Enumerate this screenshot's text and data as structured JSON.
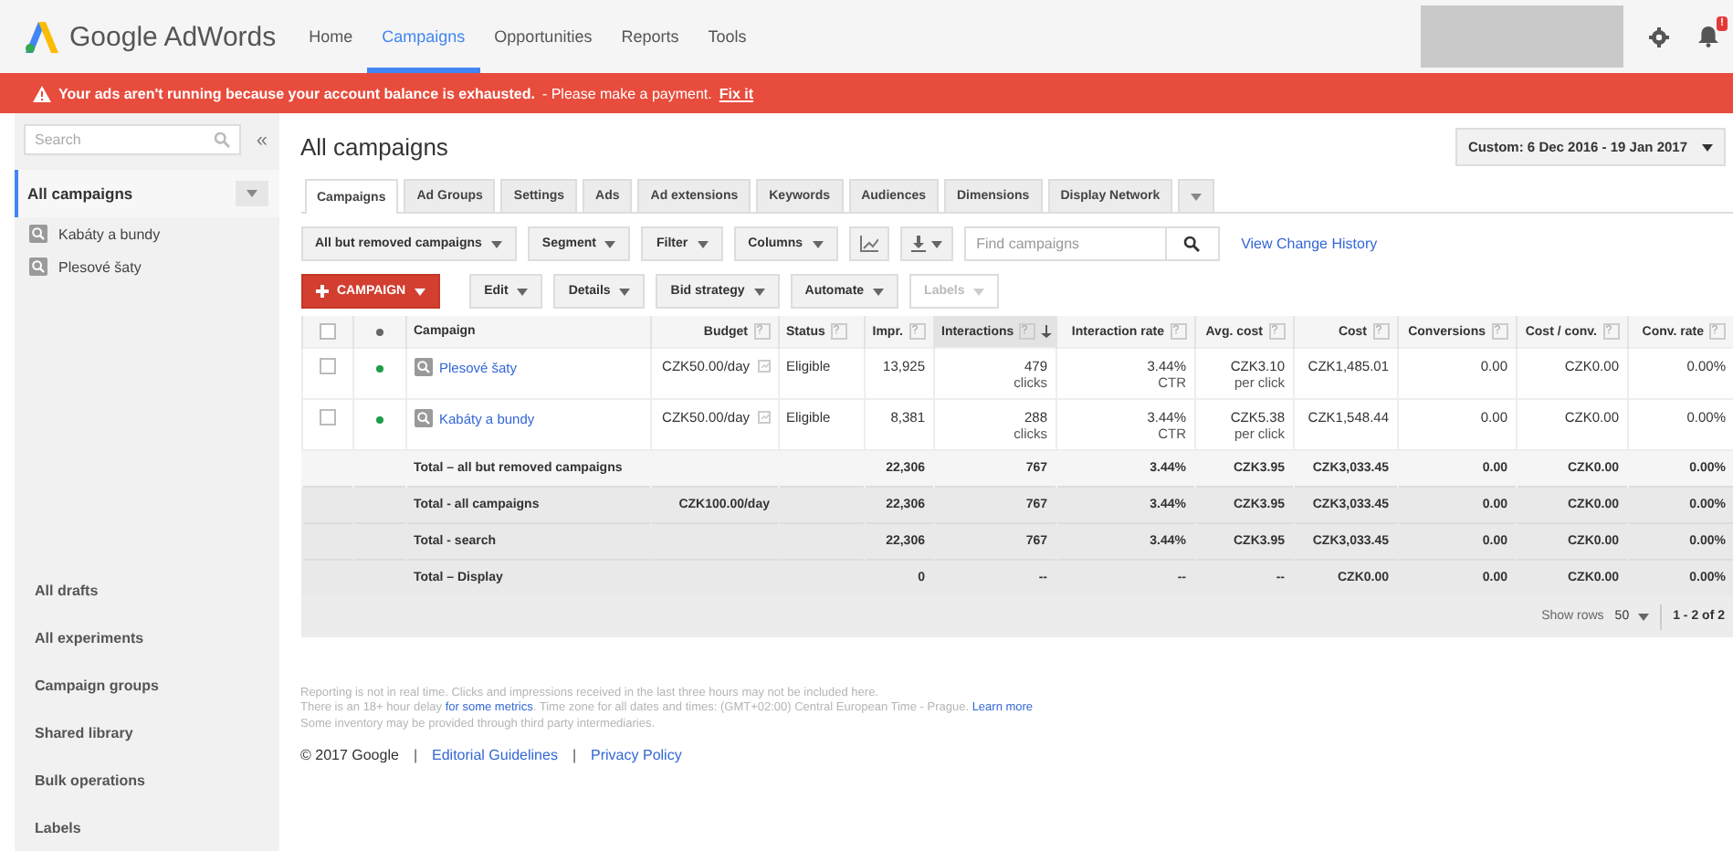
{
  "nav": {
    "brand": "Google AdWords",
    "items": [
      {
        "label": "Home",
        "selected": false
      },
      {
        "label": "Campaigns",
        "selected": true
      },
      {
        "label": "Opportunities",
        "selected": false
      },
      {
        "label": "Reports",
        "selected": false
      },
      {
        "label": "Tools",
        "selected": false
      }
    ],
    "notification_badge": "!"
  },
  "alert": {
    "message": "Your ads aren't running because your account balance is exhausted.",
    "note": "- Please make a payment.",
    "link": "Fix it"
  },
  "sidebar": {
    "search": {
      "placeholder": "Search"
    },
    "collapse": "«",
    "scope": {
      "label": "All campaigns",
      "selected": true
    },
    "campaigns": [
      {
        "label": "Kabáty a bundy",
        "selected": false
      },
      {
        "label": "Plesové šaty",
        "selected": false
      }
    ],
    "links": [
      "All drafts",
      "All experiments",
      "Campaign groups",
      "Shared library",
      "Bulk operations",
      "Labels"
    ]
  },
  "page_title": "All campaigns",
  "date_range": "Custom: 6 Dec 2016 - 19 Jan 2017",
  "tabs": [
    {
      "label": "Campaigns",
      "selected": true
    },
    {
      "label": "Ad Groups",
      "selected": false
    },
    {
      "label": "Settings",
      "selected": false
    },
    {
      "label": "Ads",
      "selected": false
    },
    {
      "label": "Ad extensions",
      "selected": false
    },
    {
      "label": "Keywords",
      "selected": false
    },
    {
      "label": "Audiences",
      "selected": false
    },
    {
      "label": "Dimensions",
      "selected": false
    },
    {
      "label": "Display Network",
      "selected": false
    }
  ],
  "toolbar": {
    "filters": [
      "All but removed campaigns",
      "Segment",
      "Filter",
      "Columns"
    ],
    "search": {
      "placeholder": "Find campaigns"
    },
    "link": "View Change History"
  },
  "actions": [
    {
      "label": "CAMPAIGN",
      "kind": "primary",
      "disabled": false
    },
    {
      "label": "Edit",
      "kind": "menu",
      "disabled": false
    },
    {
      "label": "Details",
      "kind": "menu",
      "disabled": false
    },
    {
      "label": "Bid strategy",
      "kind": "menu",
      "disabled": false
    },
    {
      "label": "Automate",
      "kind": "menu",
      "disabled": false
    },
    {
      "label": "Labels",
      "kind": "menu",
      "disabled": true
    }
  ],
  "table": {
    "columns": [
      {
        "kind": "checkbox",
        "checked": false
      },
      {
        "kind": "dot"
      },
      {
        "kind": "text",
        "label": "Campaign",
        "help": false,
        "sorted": false
      },
      {
        "kind": "number",
        "label": "Budget",
        "help": true,
        "sorted": false
      },
      {
        "kind": "text",
        "label": "Status",
        "help": true,
        "sorted": false
      },
      {
        "kind": "number",
        "label": "Impr.",
        "help": true,
        "sorted": false
      },
      {
        "kind": "number",
        "label": "Interactions",
        "help": true,
        "sorted": true
      },
      {
        "kind": "number",
        "label": "Interaction rate",
        "help": true,
        "sorted": false
      },
      {
        "kind": "number",
        "label": "Avg. cost",
        "help": true,
        "sorted": false
      },
      {
        "kind": "number",
        "label": "Cost",
        "help": true,
        "sorted": false
      },
      {
        "kind": "number",
        "label": "Conversions",
        "help": true,
        "sorted": false
      },
      {
        "kind": "number",
        "label": "Cost / conv.",
        "help": true,
        "sorted": false
      },
      {
        "kind": "number",
        "label": "Conv. rate",
        "help": true,
        "sorted": false
      }
    ],
    "rows": [
      {
        "kind": "campaign",
        "checked": false,
        "color": "#1e9e4a",
        "cells": [
          null,
          null,
          "Plesové šaty",
          "CZK50.00/day",
          "Eligible",
          "13,925",
          {
            "value": "479",
            "unit": "clicks"
          },
          {
            "value": "3.44%",
            "unit": "CTR"
          },
          {
            "value": "CZK3.10",
            "unit": "per click"
          },
          "CZK1,485.01",
          "0.00",
          "CZK0.00",
          "0.00%"
        ]
      },
      {
        "kind": "campaign",
        "checked": false,
        "color": "#1e9e4a",
        "cells": [
          null,
          null,
          "Kabáty a bundy",
          "CZK50.00/day",
          "Eligible",
          "8,381",
          {
            "value": "288",
            "unit": "clicks"
          },
          {
            "value": "3.44%",
            "unit": "CTR"
          },
          {
            "value": "CZK5.38",
            "unit": "per click"
          },
          "CZK1,548.44",
          "0.00",
          "CZK0.00",
          "0.00%"
        ]
      },
      {
        "kind": "total",
        "shaded": false,
        "cells": [
          null,
          null,
          "Total – all but removed campaigns",
          null,
          null,
          "22,306",
          "767",
          "3.44%",
          "CZK3.95",
          "CZK3,033.45",
          "0.00",
          "CZK0.00",
          "0.00%"
        ]
      },
      {
        "kind": "total",
        "shaded": true,
        "cells": [
          null,
          null,
          "Total - all campaigns",
          "CZK100.00/day",
          null,
          "22,306",
          "767",
          "3.44%",
          "CZK3.95",
          "CZK3,033.45",
          "0.00",
          "CZK0.00",
          "0.00%"
        ]
      },
      {
        "kind": "total",
        "shaded": true,
        "cells": [
          null,
          null,
          "Total - search",
          null,
          null,
          "22,306",
          "767",
          "3.44%",
          "CZK3.95",
          "CZK3,033.45",
          "0.00",
          "CZK0.00",
          "0.00%"
        ]
      },
      {
        "kind": "total",
        "shaded": true,
        "cells": [
          null,
          null,
          "Total – Display",
          null,
          null,
          "0",
          "--",
          "--",
          "--",
          "CZK0.00",
          "0.00",
          "CZK0.00",
          "0.00%"
        ]
      }
    ]
  },
  "pagination": {
    "label": "Show rows",
    "rows_per_page": "50",
    "range": "1 - 2 of 2"
  },
  "footer": {
    "notes": [
      [
        {
          "text": "Reporting is not in real time. Clicks and impressions received in the last three hours may not be included here.",
          "link": false
        }
      ],
      [
        {
          "text": "There is an 18+ hour delay ",
          "link": false
        },
        {
          "text": "for some metrics",
          "link": true
        },
        {
          "text": ". Time zone for all dates and times: (GMT+02:00) Central European Time - Prague. ",
          "link": false
        },
        {
          "text": "Learn more",
          "link": true
        }
      ],
      [
        {
          "text": "Some inventory may be provided through third party intermediaries.",
          "link": false
        }
      ]
    ],
    "copyright": "© 2017 Google",
    "separator": "|",
    "links": [
      "Editorial Guidelines",
      "Privacy Policy"
    ]
  }
}
